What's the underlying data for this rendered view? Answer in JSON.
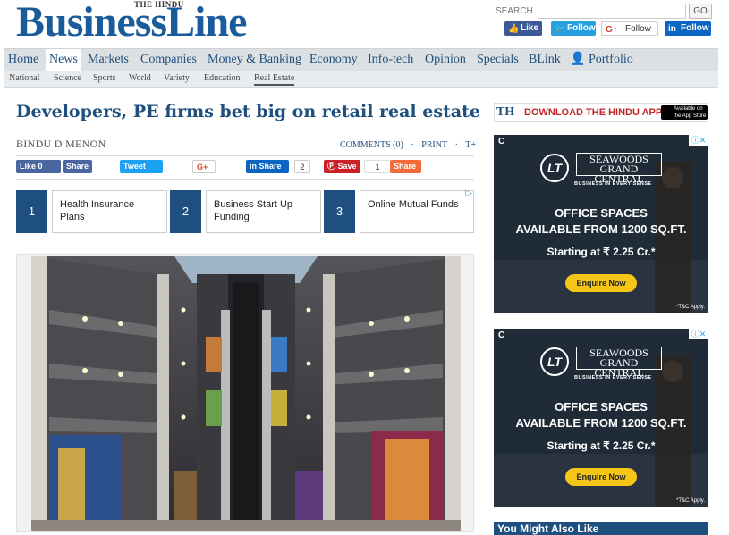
{
  "masthead": {
    "prefix": "THE HINDU",
    "title": "BusinessLine"
  },
  "search": {
    "label": "SEARCH",
    "value": "",
    "go": "GO"
  },
  "social": {
    "fb": "Like",
    "twitter": "Follow",
    "gplus": "Follow",
    "linkedin": "Follow"
  },
  "nav": {
    "items": [
      "Home",
      "News",
      "Markets",
      "Companies",
      "Money & Banking",
      "Economy",
      "Info-tech",
      "Opinion",
      "Specials",
      "BLink",
      "Portfolio"
    ],
    "active": "News"
  },
  "subnav": {
    "items": [
      "National",
      "Science",
      "Sports",
      "World",
      "Variety",
      "Education",
      "Real Estate"
    ],
    "active": "Real Estate"
  },
  "article": {
    "headline": "Developers, PE firms bet big on retail real estate",
    "author": "BINDU D MENON",
    "comments": "COMMENTS (0)",
    "print": "PRINT",
    "textsize": "T+"
  },
  "share": {
    "fb_like": "Like 0",
    "fb_share": "Share",
    "tweet": "Tweet",
    "gplus": "G+",
    "li_share": "Share",
    "li_count": "2",
    "pin": "Save",
    "pin_count": "1",
    "share": "Share"
  },
  "related": [
    {
      "num": "1",
      "text": "Health Insurance Plans"
    },
    {
      "num": "2",
      "text": "Business Start Up Funding"
    },
    {
      "num": "3",
      "text": "Online Mutual Funds"
    }
  ],
  "th_banner": {
    "logo": "TH",
    "text": "DOWNLOAD THE HINDU APP",
    "appstore": "Available on the App Store"
  },
  "ad": {
    "brand_line1": "SEAWOODS",
    "brand_line2": "GRAND CENTRAL",
    "tagline": "BUSINESS IN EVERY SENSE",
    "line1": "OFFICE SPACES",
    "line2": "AVAILABLE FROM 1200 SQ.FT.",
    "line3": "Starting at ₹ 2.25 Cr.*",
    "cta": "Enquire Now",
    "tc": "*T&C Apply."
  },
  "sidebar": {
    "you_might": "You Might Also Like"
  }
}
